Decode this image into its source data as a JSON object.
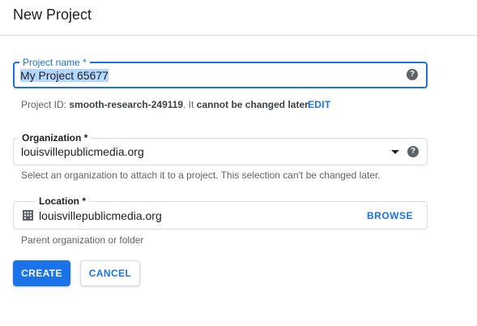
{
  "dialog": {
    "title": "New Project"
  },
  "project_name": {
    "label": "Project name *",
    "value": "My Project 65677",
    "help_icon": "help-circle-icon"
  },
  "project_id": {
    "prefix": "Project ID: ",
    "id": "smooth-research-249119",
    "middle": ". It ",
    "emphasis": "cannot be changed later.",
    "edit_label": "EDIT"
  },
  "organization": {
    "label": "Organization *",
    "selected": "louisvillepublicmedia.org",
    "help_text": "Select an organization to attach it to a project. This selection can't be changed later.",
    "dropdown_icon": "arrow-drop-down-icon",
    "help_icon": "help-circle-icon"
  },
  "location": {
    "label": "Location *",
    "value": "louisvillepublicmedia.org",
    "browse_label": "BROWSE",
    "help_text": "Parent organization or folder",
    "icon": "building-icon"
  },
  "actions": {
    "create_label": "CREATE",
    "cancel_label": "CANCEL"
  },
  "colors": {
    "accent": "#1a73e8",
    "selection": "#b3d7fe",
    "secondary_text": "#5f6368",
    "border": "#dadce0"
  }
}
